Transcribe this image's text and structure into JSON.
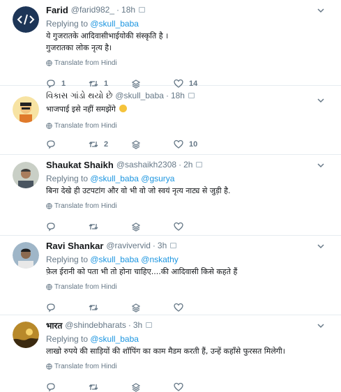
{
  "tweets": [
    {
      "name": "Farid",
      "handle": "@farid982_",
      "time": "18h",
      "replying_prefix": "Replying to ",
      "replying_to": "@skull_baba",
      "text_lines": [
        "ये गुजरातके आदिवासीभाईयोकी संस्कृति है ।",
        "गुजरातका लोक नृत्य है।"
      ],
      "translate_label": "Translate from Hindi",
      "replies": "1",
      "retweets": "1",
      "likes": "14",
      "avatar_icon": "code-icon"
    },
    {
      "name": "વિકાસ ગાંડો થયો છે",
      "handle": "@skull_baba",
      "time": "18h",
      "replying_prefix": "",
      "replying_to": "",
      "text_lines": [
        "भाजपाई इसे नहीं समझेंगे"
      ],
      "has_emoji": true,
      "translate_label": "Translate from Hindi",
      "replies": "",
      "retweets": "2",
      "likes": "10",
      "avatar_icon": "cartoon-avatar-icon"
    },
    {
      "name": "Shaukat Shaikh",
      "handle": "@sashaikh2308",
      "time": "2h",
      "replying_prefix": "Replying to ",
      "replying_to": "@skull_baba @gsurya",
      "text_lines": [
        "बिना देखे ही उटपटांग और वो भी वो जो स्वयं नृत्य नाट्य से जुड़ी है."
      ],
      "translate_label": "Translate from Hindi",
      "replies": "",
      "retweets": "",
      "likes": "",
      "avatar_icon": "person-photo-icon"
    },
    {
      "name": "Ravi Shankar",
      "handle": "@ravivervid",
      "time": "3h",
      "replying_prefix": "Replying to ",
      "replying_to": "@skull_baba @nskathy",
      "text_lines": [
        "फ़ेल ईरानी को पता भी तो होना चाहिए....की आदिवासी किसे कहते हैं"
      ],
      "translate_label": "Translate from Hindi",
      "replies": "",
      "retweets": "",
      "likes": "",
      "avatar_icon": "person-photo-icon"
    },
    {
      "name": "भारत",
      "handle": "@shindebharats",
      "time": "3h",
      "replying_prefix": "Replying to ",
      "replying_to": "@skull_baba",
      "text_lines": [
        "लाखो रुपये की साड़ियों की शॉपिंग का काम मैडम करती हैं, उन्हें कहाँसे फुरसत मिलेगी।"
      ],
      "translate_label": "Translate from Hindi",
      "replies": "",
      "retweets": "",
      "likes": "",
      "avatar_icon": "sunset-photo-icon"
    }
  ]
}
